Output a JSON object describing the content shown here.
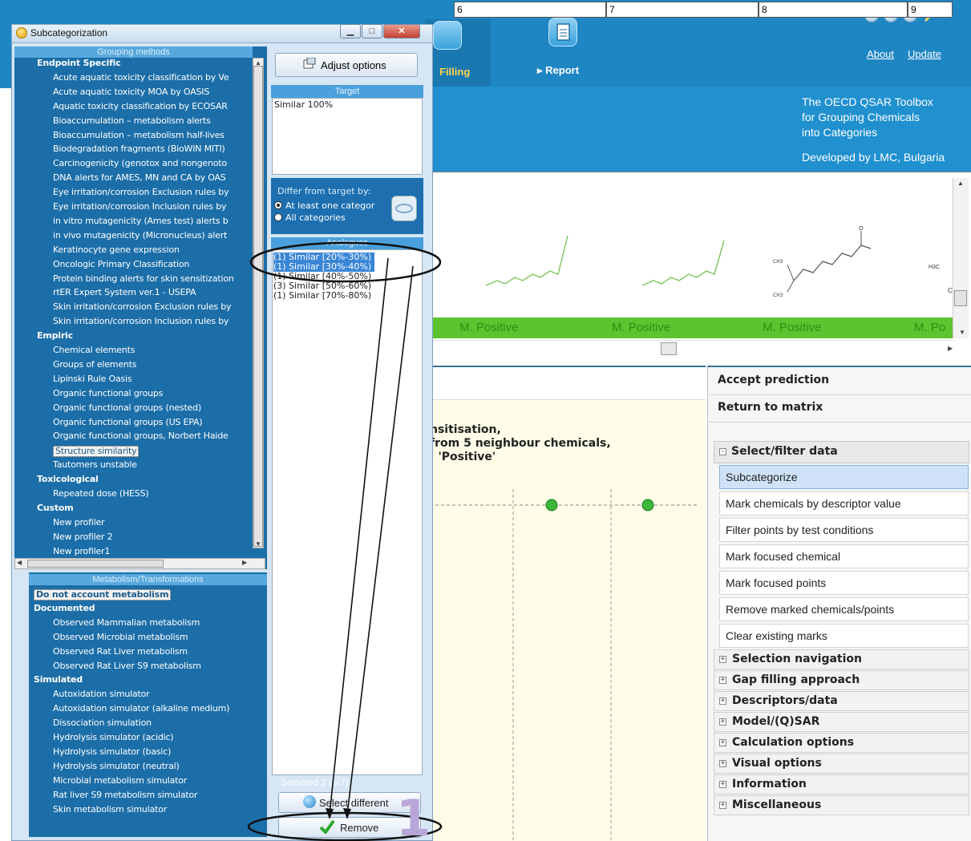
{
  "app": {
    "tabs": {
      "filling": "Filling",
      "report": "Report"
    },
    "links": {
      "about": "About",
      "update": "Update"
    },
    "tagline": [
      "The OECD QSAR Toolbox",
      "for Grouping Chemicals",
      "into Categories"
    ],
    "developed_by": "Developed by LMC, Bulgaria"
  },
  "matrix": {
    "columns": [
      "6",
      "7",
      "8",
      "9"
    ],
    "results": [
      "M. Positive",
      "M. Positive",
      "M. Positive",
      "M. Po"
    ],
    "structure_labels": {
      "col8_top": "O",
      "col8_left": "CH3",
      "col9_a": "H3C",
      "col9_b": "C"
    }
  },
  "chart": {
    "lines": [
      "nsitisation,",
      "from 5 neighbour chemicals,",
      ": 'Positive'"
    ]
  },
  "right_panel": {
    "accept": "Accept prediction",
    "return": "Return to matrix",
    "select_filter": {
      "title": "Select/filter data",
      "items": [
        "Subcategorize",
        "Mark chemicals by descriptor value",
        "Filter points by test conditions",
        "Mark focused chemical",
        "Mark focused points",
        "Remove marked chemicals/points",
        "Clear existing marks"
      ],
      "active_index": 0
    },
    "groups": [
      "Selection navigation",
      "Gap filling approach",
      "Descriptors/data",
      "Model/(Q)SAR",
      "Calculation options",
      "Visual options",
      "Information",
      "Miscellaneous"
    ]
  },
  "dialog": {
    "title": "Subcategorization",
    "grouping_header": "Grouping methods",
    "grouping": [
      {
        "t": "Endpoint Specific",
        "cat": true
      },
      {
        "t": "Acute aquatic toxicity classification by Ve"
      },
      {
        "t": "Acute aquatic toxicity MOA by OASIS"
      },
      {
        "t": "Aquatic toxicity classification by ECOSAR"
      },
      {
        "t": "Bioaccumulation – metabolism alerts"
      },
      {
        "t": "Bioaccumulation – metabolism half-lives"
      },
      {
        "t": "Biodegradation fragments (BioWIN MITI)"
      },
      {
        "t": "Carcinogenicity (genotox and nongenoto"
      },
      {
        "t": "DNA alerts for AMES, MN and CA by OAS"
      },
      {
        "t": "Eye irritation/corrosion Exclusion rules by"
      },
      {
        "t": "Eye irritation/corrosion Inclusion rules by"
      },
      {
        "t": "in vitro mutagenicity (Ames test) alerts b"
      },
      {
        "t": "in vivo mutagenicity (Micronucleus) alert"
      },
      {
        "t": "Keratinocyte gene expression"
      },
      {
        "t": "Oncologic Primary Classification"
      },
      {
        "t": "Protein binding alerts for skin sensitization"
      },
      {
        "t": "rtER Expert System ver.1 - USEPA"
      },
      {
        "t": "Skin irritation/corrosion Exclusion rules by"
      },
      {
        "t": "Skin irritation/corrosion Inclusion rules by"
      },
      {
        "t": "Empiric",
        "cat": true
      },
      {
        "t": "Chemical elements"
      },
      {
        "t": "Groups of elements"
      },
      {
        "t": "Lipinski Rule Oasis"
      },
      {
        "t": "Organic functional groups"
      },
      {
        "t": "Organic functional groups (nested)"
      },
      {
        "t": "Organic functional groups (US EPA)"
      },
      {
        "t": "Organic functional groups, Norbert Haide"
      },
      {
        "t": "Structure similarity",
        "sel": true
      },
      {
        "t": "Tautomers unstable"
      },
      {
        "t": "Toxicological",
        "cat": true
      },
      {
        "t": "Repeated dose (HESS)"
      },
      {
        "t": "Custom",
        "cat": true
      },
      {
        "t": "New profiler"
      },
      {
        "t": "New profiler 2"
      },
      {
        "t": "New profiler1"
      }
    ],
    "metabolism_header": "Metabolism/Transformations",
    "metabolism": [
      {
        "t": "Do not account metabolism",
        "sel": true,
        "cat": true
      },
      {
        "t": "Documented",
        "cat": true
      },
      {
        "t": "Observed Mammalian metabolism"
      },
      {
        "t": "Observed Microbial metabolism"
      },
      {
        "t": "Observed Rat Liver metabolism"
      },
      {
        "t": "Observed Rat Liver S9  metabolism"
      },
      {
        "t": "Simulated",
        "cat": true
      },
      {
        "t": "Autoxidation simulator"
      },
      {
        "t": "Autoxidation simulator (alkaline medium)"
      },
      {
        "t": "Dissociation simulation"
      },
      {
        "t": "Hydrolysis simulator (acidic)"
      },
      {
        "t": "Hydrolysis simulator (basic)"
      },
      {
        "t": "Hydrolysis simulator (neutral)"
      },
      {
        "t": "Microbial metabolism simulator"
      },
      {
        "t": "Rat liver S9 metabolism simulator"
      },
      {
        "t": "Skin metabolism simulator"
      }
    ],
    "adjust_options": "Adjust options",
    "target_header": "Target",
    "target_value": "Similar 100%",
    "differ_label": "Differ from target by:",
    "differ_options": [
      "At least one categor",
      "All categories"
    ],
    "differ_selected": 0,
    "analogues_header": "Analogues",
    "analogues": [
      {
        "t": "(1) Similar [20%-30%)",
        "sel": true
      },
      {
        "t": "(1) Similar [30%-40%)",
        "sel": true
      },
      {
        "t": "(1) Similar [40%-50%)"
      },
      {
        "t": "(3) Similar [50%-60%)"
      },
      {
        "t": "(1) Similar [70%-80%)"
      }
    ],
    "selected_count": "Selected 2 (5/7)",
    "select_different": "Select different",
    "remove": "Remove",
    "annotation_number": "1"
  },
  "colors": {
    "app_blue": "#1f86c4",
    "dialog_tree_blue": "#1c6ea8",
    "result_green": "#5cc42f",
    "selection_blue": "#3a86d6"
  }
}
